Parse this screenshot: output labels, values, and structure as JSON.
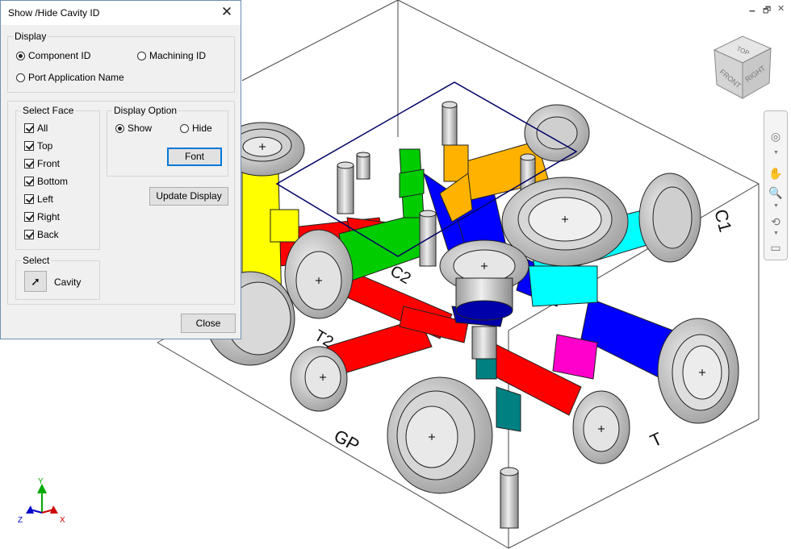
{
  "dialog": {
    "title": "Show /Hide  Cavity ID",
    "display_group": {
      "legend": "Display",
      "options": [
        {
          "label": "Component ID",
          "selected": true
        },
        {
          "label": "Machining ID",
          "selected": false
        },
        {
          "label": "Port Application Name",
          "selected": false
        }
      ]
    },
    "select_face": {
      "legend": "Select Face",
      "items": [
        {
          "label": "All",
          "checked": true
        },
        {
          "label": "Top",
          "checked": true
        },
        {
          "label": "Front",
          "checked": true
        },
        {
          "label": "Bottom",
          "checked": true
        },
        {
          "label": "Left",
          "checked": true
        },
        {
          "label": "Right",
          "checked": true
        },
        {
          "label": "Back",
          "checked": true
        }
      ]
    },
    "display_option": {
      "legend": "Display Option",
      "show_label": "Show",
      "hide_label": "Hide",
      "selected": "Show",
      "font_button": "Font"
    },
    "update_button": "Update Display",
    "select_group": {
      "legend": "Select",
      "cavity_label": "Cavity"
    },
    "close_button": "Close"
  },
  "model_labels": {
    "c2": "C2",
    "t2": "T2",
    "gp": "GP",
    "t": "T",
    "c1": "C1"
  },
  "viewcube": {
    "top": "TOP",
    "front": "FRONT",
    "right": "RIGHT"
  },
  "axes": {
    "x": "X",
    "y": "Y",
    "z": "Z"
  },
  "colors": {
    "red": "#ff0000",
    "yellow": "#ffff00",
    "green": "#00cc00",
    "blue": "#0000ff",
    "cyan": "#00ffff",
    "orange": "#ffb300",
    "magenta": "#ff00cc",
    "teal": "#008080",
    "navy": "#000080",
    "steel": "#d9d9d9",
    "selection": "#000066"
  }
}
